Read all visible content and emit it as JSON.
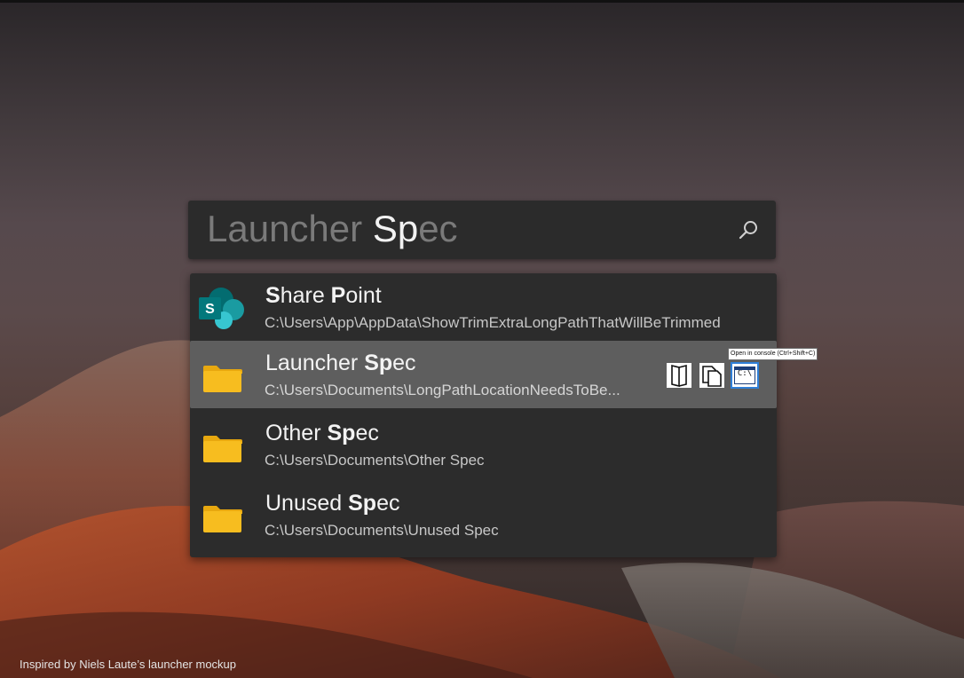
{
  "search": {
    "typed_text": "Launcher Sp",
    "typed_muted": "Launcher ",
    "typed_active": "Sp",
    "completion": "ec"
  },
  "results": [
    {
      "title_bold_1": "S",
      "title_rest_1": "hare ",
      "title_bold_2": "P",
      "title_rest_2": "oint",
      "path": "C:\\Users\\App\\AppData\\ShowTrimExtraLongPathThatWillBeTrimmed",
      "icon": "sharepoint-icon"
    },
    {
      "title_prefix": "Launcher ",
      "title_match": "Sp",
      "title_suffix": "ec",
      "path": "C:\\Users\\Documents\\LongPathLocationNeedsToBe...",
      "icon": "folder-icon",
      "selected": true
    },
    {
      "title_prefix": "Other ",
      "title_match": "Sp",
      "title_suffix": "ec",
      "path": "C:\\Users\\Documents\\Other Spec",
      "icon": "folder-icon"
    },
    {
      "title_prefix": "Unused ",
      "title_match": "Sp",
      "title_suffix": "ec",
      "path": "C:\\Users\\Documents\\Unused Spec",
      "icon": "folder-icon"
    }
  ],
  "actions": {
    "icons": [
      "open-folder-icon",
      "copy-path-icon",
      "console-icon"
    ],
    "console_glyph": "C:\\",
    "tooltip": "Open in console (Ctrl+Shift+C)"
  },
  "footer": {
    "credit": "Inspired by Niels Laute’s launcher mockup"
  },
  "colors": {
    "search_bg": "#2b2b2b",
    "results_bg": "#2c2c2c",
    "selected_bg": "#5e5e5e",
    "folder": "#f5b81d",
    "sharepoint_teal": "#0b8a87",
    "focus_border": "#2f7fd8"
  }
}
